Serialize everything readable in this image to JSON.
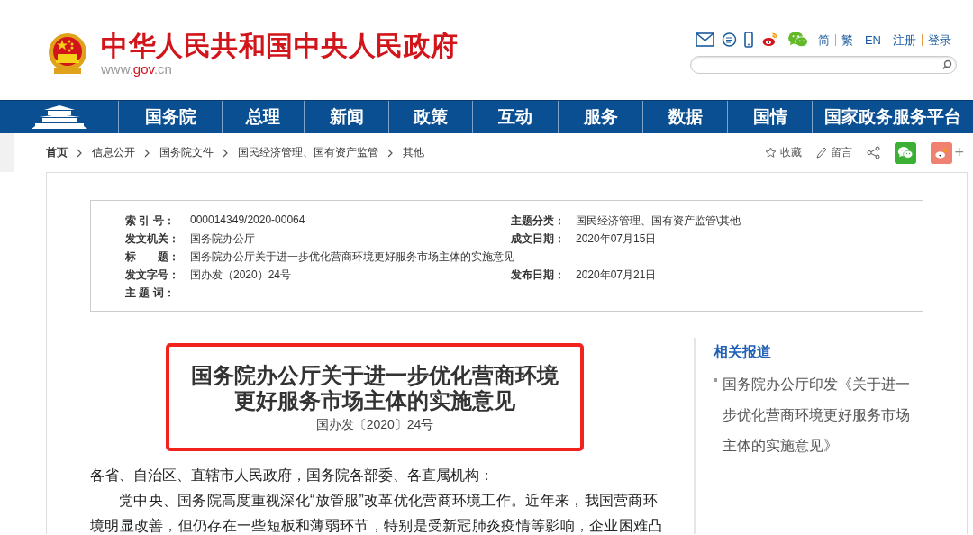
{
  "header": {
    "site_title": "中华人民共和国中央人民政府",
    "url_prefix": "www.",
    "url_domain": "gov",
    "url_suffix": ".cn",
    "lang_links": [
      "简",
      "繁",
      "EN",
      "注册",
      "登录"
    ]
  },
  "nav": {
    "items": [
      "国务院",
      "总理",
      "新闻",
      "政策",
      "互动",
      "服务",
      "数据",
      "国情",
      "国家政务服务平台"
    ]
  },
  "breadcrumb": [
    "首页",
    "信息公开",
    "国务院文件",
    "国民经济管理、国有资产监管",
    "其他"
  ],
  "toolbar": {
    "favorite": "收藏",
    "comment": "留言",
    "more": "+"
  },
  "info": {
    "rows": [
      {
        "cells": [
          {
            "label": "索 引 号：",
            "value": "000014349/2020-00064"
          },
          {
            "label": "主题分类：",
            "value": "国民经济管理、国有资产监管\\其他"
          }
        ]
      },
      {
        "cells": [
          {
            "label": "发文机关：",
            "value": "国务院办公厅"
          },
          {
            "label": "成文日期：",
            "value": "2020年07月15日"
          }
        ]
      },
      {
        "cells": [
          {
            "label": "标　　题：",
            "value": "国务院办公厅关于进一步优化营商环境更好服务市场主体的实施意见"
          }
        ]
      },
      {
        "cells": [
          {
            "label": "发文字号：",
            "value": "国办发（2020）24号"
          },
          {
            "label": "发布日期：",
            "value": "2020年07月21日"
          }
        ]
      },
      {
        "cells": [
          {
            "label": "主 题 词："
          }
        ]
      }
    ]
  },
  "article": {
    "title_lines": [
      "国务院办公厅关于进一步优化营商环境",
      "更好服务市场主体的实施意见"
    ],
    "doc_number": "国办发〔2020〕24号",
    "salutation": "各省、自治区、直辖市人民政府，国务院各部委、各直属机构：",
    "paragraph": "党中央、国务院高度重视深化“放管服”改革优化营商环境工作。近年来，我国营商环境明显改善，但仍存在一些短板和薄弱环节，特别是受新冠肺炎疫情等影响，企业困难凸"
  },
  "related": {
    "heading": "相关报道",
    "items": [
      "国务院办公厅印发《关于进一步优化营商环境更好服务市场主体的实施意见》"
    ]
  }
}
